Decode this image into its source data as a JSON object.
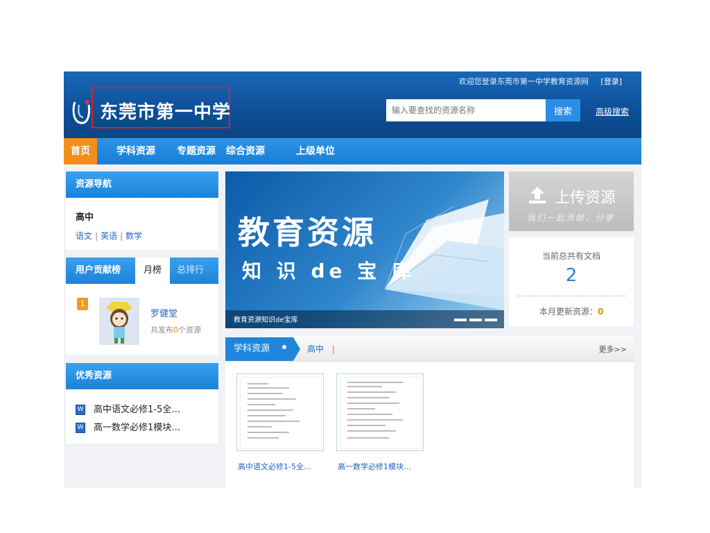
{
  "header": {
    "welcome_text": "欢迎您登录东莞市第一中学教育资源网",
    "login_link": "[登录]",
    "school_name": "东莞市第一中学",
    "search_placeholder": "输入要查找的资源名称",
    "search_button": "搜索",
    "advanced_search": "高级搜索"
  },
  "nav": {
    "items": [
      {
        "label": "首页",
        "active": true
      },
      {
        "label": "学科资源",
        "active": false
      },
      {
        "label": "专题资源",
        "active": false
      },
      {
        "label": "综合资源",
        "active": false
      },
      {
        "label": "上级单位",
        "active": false
      }
    ]
  },
  "resource_nav": {
    "title": "资源导航",
    "level": "高中",
    "subjects": [
      "语文",
      "英语",
      "数学"
    ],
    "separator": "|"
  },
  "ranking": {
    "title": "用户贡献榜",
    "tab_month": "月榜",
    "tab_total": "总排行",
    "entries": [
      {
        "rank": "1",
        "user": "罗健堂",
        "count_prefix": "共发布",
        "count": "0",
        "count_suffix": "个资源"
      }
    ]
  },
  "fine_resources": {
    "title": "优秀资源",
    "items": [
      "高中语文必修1-5全…",
      "高一数学必修1模块…"
    ],
    "icon_letter": "W"
  },
  "banner": {
    "headline": "教育资源",
    "subline": "知 识 de 宝 库",
    "caption": "教育资源知识de宝库"
  },
  "upload": {
    "label": "上传资源",
    "subtitle": "我们一起贡献、分享"
  },
  "stats": {
    "title": "当前总共有文档",
    "count": "2",
    "month_label": "本月更新资源：",
    "month_count": "0"
  },
  "subject_section": {
    "tab_label": "学科资源",
    "level": "高中",
    "level_sep": "|",
    "more": "更多>>",
    "docs": [
      {
        "caption": "高中语文必修1-5全…"
      },
      {
        "caption": "高一数学必修1模块…"
      }
    ]
  },
  "colors": {
    "header_blue": "#0d4f96",
    "nav_blue": "#1a7fd6",
    "active_orange": "#f18f1a",
    "highlight_red": "#d2232a",
    "link_blue": "#2266bb"
  }
}
